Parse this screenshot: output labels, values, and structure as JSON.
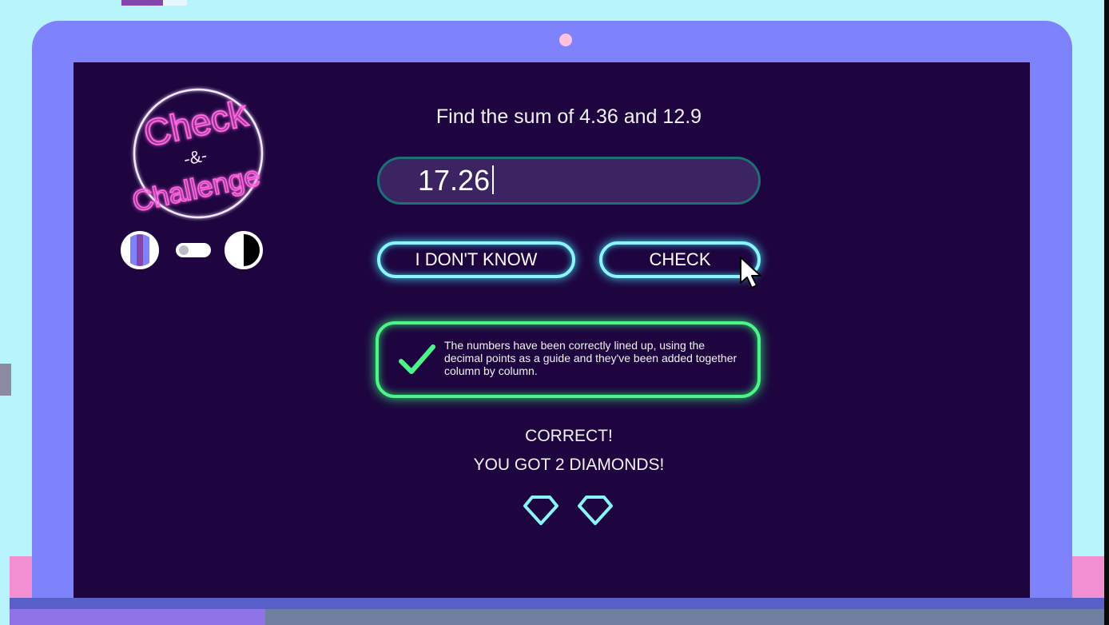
{
  "logo": {
    "line1": "Check",
    "line2": "-&-",
    "line3": "Challenge"
  },
  "mode_toggle": {
    "left_icon": "striped-color-mode-icon",
    "right_icon": "high-contrast-mode-icon",
    "state": "left"
  },
  "question": {
    "text": "Find the sum of 4.36 and 12.9"
  },
  "answer": {
    "value": "17.26"
  },
  "buttons": {
    "dont_know": "I DON'T KNOW",
    "check": "CHECK"
  },
  "feedback": {
    "icon": "checkmark-icon",
    "text": "The numbers have been correctly lined up, using the decimal points as a guide and they've been added together column by column."
  },
  "result": {
    "status": "CORRECT!",
    "reward": "YOU GOT 2 DIAMONDS!",
    "diamonds": 2
  },
  "colors": {
    "screen_background": "#1e0540",
    "laptop_frame": "#7f83fb",
    "button_glow": "#8af4ff",
    "correct_glow": "#4cf48a",
    "logo_neon": "#ff66e0"
  }
}
